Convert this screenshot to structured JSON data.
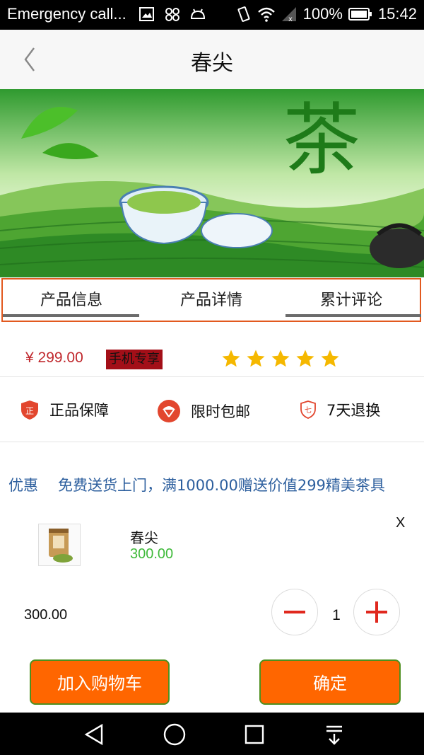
{
  "status_bar": {
    "left_text": "Emergency call...",
    "battery": "100%",
    "time": "15:42",
    "icons": [
      "image-icon",
      "voicemail-icon",
      "android-icon",
      "vibrate-icon",
      "wifi-icon",
      "signal-icon",
      "battery-icon"
    ]
  },
  "header": {
    "title": "春尖",
    "back_icon": "chevron-left-icon"
  },
  "banner": {
    "image": "tea-plantation-banner",
    "calligraphy": "茶"
  },
  "tabs": [
    {
      "label": "产品信息"
    },
    {
      "label": "产品详情"
    },
    {
      "label": "累计评论"
    }
  ],
  "product": {
    "price": "¥ 299.00",
    "badge": "手机专享",
    "rating_stars": 5
  },
  "guarantees": [
    {
      "label": "正品保障",
      "icon": "authentic-shield-icon"
    },
    {
      "label": "限时包邮",
      "icon": "shipping-parachute-icon"
    },
    {
      "label": "7天退换",
      "icon": "seven-day-return-icon"
    }
  ],
  "promo": {
    "label": "优惠",
    "text": "免费送货上门，满1000.00赠送价值299精美茶具"
  },
  "cart_item": {
    "name": "春尖",
    "price": "300.00",
    "close": "X",
    "thumbnail": "tea-can-thumbnail"
  },
  "order": {
    "total": "300.00",
    "quantity": "1"
  },
  "buttons": {
    "add_to_cart": "加入购物车",
    "confirm": "确定"
  },
  "colors": {
    "accent": "#ff6600",
    "price_red": "#c0282d",
    "promo_blue": "#2d5f9e",
    "green_price": "#3fba3a",
    "star": "#f5b800",
    "tab_border": "#e2591f"
  },
  "nav_icons": [
    "back-triangle-icon",
    "home-circle-icon",
    "recents-square-icon",
    "notification-down-icon"
  ]
}
